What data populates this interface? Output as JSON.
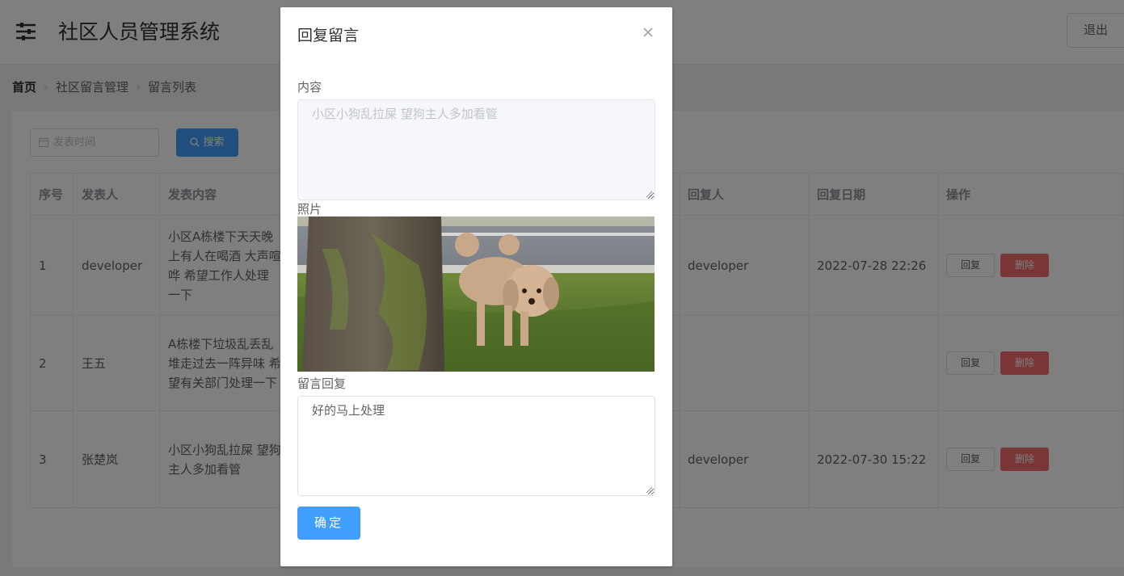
{
  "header": {
    "title": "社区人员管理系统",
    "logout_label": "退出"
  },
  "breadcrumb": {
    "home": "首页",
    "level1": "社区留言管理",
    "level2": "留言列表"
  },
  "filters": {
    "date_placeholder": "发表时间",
    "search_label": "搜索"
  },
  "table": {
    "columns": [
      "序号",
      "发表人",
      "发表内容",
      "回复人",
      "回复日期",
      "操作"
    ],
    "rows": [
      {
        "index": "1",
        "author": "developer",
        "content_lines": [
          "小区A栋楼下天天晚",
          "上有人在喝酒 大声喧",
          "哗 希望工作人处理",
          "一下"
        ],
        "replier": "developer",
        "reply_date": "2022-07-28 22:26"
      },
      {
        "index": "2",
        "author": "王五",
        "content_lines": [
          "A栋楼下垃圾乱丢乱",
          "堆走过去一阵异味 希",
          "望有关部门处理一下"
        ],
        "replier": "",
        "reply_date": ""
      },
      {
        "index": "3",
        "author": "张楚岚",
        "content_lines": [
          "小区小狗乱拉屎 望狗",
          "主人多加看管"
        ],
        "replier": "developer",
        "reply_date": "2022-07-30 15:22"
      }
    ],
    "reply_label": "回复",
    "delete_label": "删除"
  },
  "dialog": {
    "title": "回复留言",
    "content_label": "内容",
    "content_value": "小区小狗乱拉屎  望狗主人多加看管",
    "photo_label": "照片",
    "reply_label": "留言回复",
    "reply_value": "好的马上处理",
    "confirm_label": "确定"
  },
  "colors": {
    "primary": "#409eff",
    "danger": "#f56c6c",
    "overlay": "rgba(0,0,0,0.5)"
  }
}
